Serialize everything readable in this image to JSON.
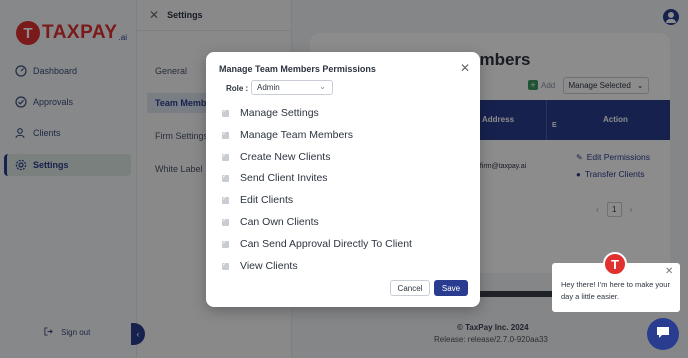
{
  "brand": {
    "logo_letter": "T",
    "name": "TAXPAY",
    "suffix": ".ai"
  },
  "sidebar": {
    "items": [
      {
        "label": "Dashboard",
        "icon": "dashboard-icon"
      },
      {
        "label": "Approvals",
        "icon": "check-circle-icon"
      },
      {
        "label": "Clients",
        "icon": "users-icon"
      },
      {
        "label": "Settings",
        "icon": "gear-icon",
        "active": true
      }
    ],
    "signout_label": "Sign out",
    "collapse_glyph": "‹"
  },
  "settings_panel": {
    "title": "Settings",
    "tabs": [
      {
        "label": "General"
      },
      {
        "label": "Team Members",
        "active": true
      },
      {
        "label": "Firm Settings"
      },
      {
        "label": "White Label"
      }
    ]
  },
  "main": {
    "title": "embers",
    "add_label": "Add",
    "manage_selected_label": "Manage Selected",
    "table": {
      "headers": {
        "address": "Address",
        "e": "E",
        "action": "Action"
      },
      "rows": [
        {
          "email": "ofirm@taxpay.ai",
          "edit_label": "Edit Permissions",
          "transfer_label": "Transfer Clients"
        }
      ]
    },
    "pagination": {
      "current": "1",
      "prev": "‹",
      "next": "›"
    }
  },
  "footer": {
    "copyright": "© TaxPay Inc. 2024",
    "release": "Release: release/2.7.0-920aa33"
  },
  "modal": {
    "title": "Manage Team Members Permissions",
    "role_label": "Role :",
    "role_value": "Admin",
    "permissions": [
      {
        "label": "Manage Settings",
        "checked": true
      },
      {
        "label": "Manage Team Members",
        "checked": true
      },
      {
        "label": "Create New Clients",
        "checked": true
      },
      {
        "label": "Send Client Invites",
        "checked": true
      },
      {
        "label": "Edit Clients",
        "checked": true
      },
      {
        "label": "Can Own Clients",
        "checked": true
      },
      {
        "label": "Can Send Approval Directly To Client",
        "checked": true
      },
      {
        "label": "View Clients",
        "checked": true
      }
    ],
    "cancel_label": "Cancel",
    "save_label": "Save"
  },
  "chat": {
    "message": "Hey there! I'm here to make your day a little easier."
  },
  "colors": {
    "brand_red": "#e03030",
    "primary": "#2a3c8f"
  }
}
